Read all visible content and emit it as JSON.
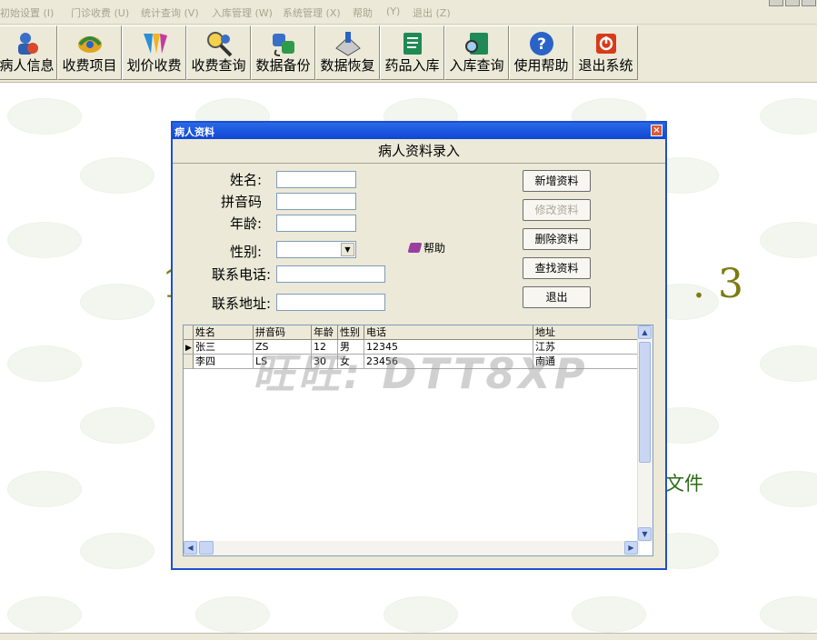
{
  "menu": [
    "初始设置 (I)",
    "门诊收费 (U)",
    "统计查询 (V)",
    "入库管理 (W)",
    "系统管理 (X)",
    "帮助",
    "(Y)",
    "退出 (Z)"
  ],
  "toolbar": [
    {
      "label": "病人信息",
      "icon": "patient-icon"
    },
    {
      "label": "收费项目",
      "icon": "fee-items-icon"
    },
    {
      "label": "划价收费",
      "icon": "pricing-icon"
    },
    {
      "label": "收费查询",
      "icon": "search-icon"
    },
    {
      "label": "数据备份",
      "icon": "backup-icon"
    },
    {
      "label": "数据恢复",
      "icon": "restore-icon"
    },
    {
      "label": "药品入库",
      "icon": "medicine-in-icon"
    },
    {
      "label": "入库查询",
      "icon": "stock-query-icon"
    },
    {
      "label": "使用帮助",
      "icon": "help-icon"
    },
    {
      "label": "退出系统",
      "icon": "power-icon"
    }
  ],
  "background": {
    "big_text": ". 3",
    "left_text": "1",
    "small_text": "文件"
  },
  "dialog": {
    "title": "病人资料",
    "close": "×",
    "heading": "病人资料录入",
    "labels": {
      "name": "姓名:",
      "pinyin": "拼音码",
      "age": "年龄:",
      "gender": "性别:",
      "phone": "联系电话:",
      "address": "联系地址:"
    },
    "values": {
      "name": "",
      "pinyin": "",
      "age": "",
      "gender": "",
      "phone": "",
      "address": ""
    },
    "help_label": "帮助",
    "buttons": {
      "add": "新增资料",
      "edit": "修改资料",
      "delete": "删除资料",
      "find": "查找资料",
      "exit": "退出"
    }
  },
  "grid": {
    "columns": [
      "姓名",
      "拼音码",
      "年龄",
      "性别",
      "电话",
      "地址"
    ],
    "rows": [
      [
        "张三",
        "ZS",
        "12",
        "男",
        "12345",
        "江苏"
      ],
      [
        "李四",
        "LS",
        "30",
        "女",
        "23456",
        "南通"
      ]
    ]
  },
  "watermark": "旺旺: DTT8XP",
  "colors": {
    "titlebar": "#1c4fd2",
    "face": "#ece9d8",
    "accent_text": "#7d7a12"
  }
}
